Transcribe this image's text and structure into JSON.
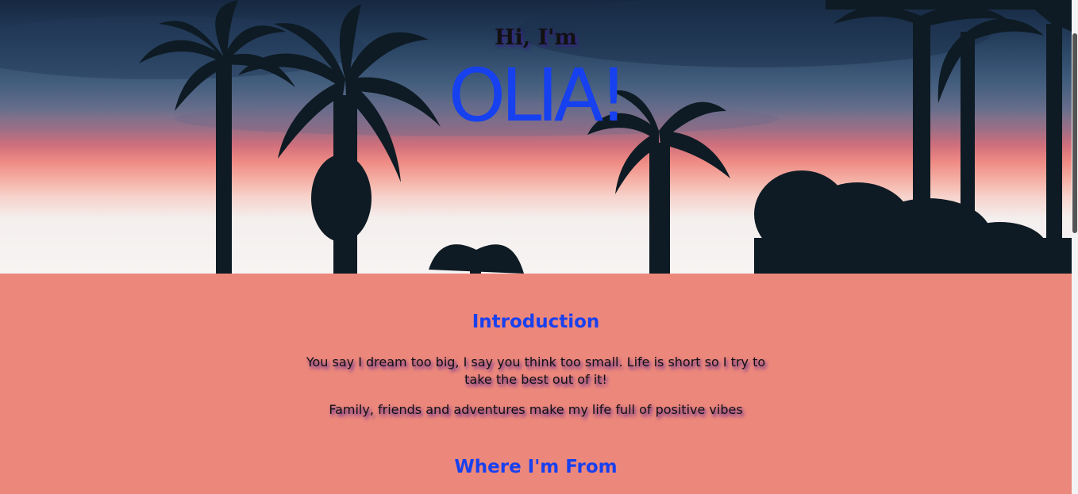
{
  "hero": {
    "greeting": "Hi, I'm",
    "name": "OLIA!"
  },
  "intro": {
    "title": "Introduction",
    "paragraph_1": "You say I dream too big, I say you think too small. Life is short so I try to take the best out of it!",
    "paragraph_2": "Family, friends and adventures make my life full of positive vibes"
  },
  "where_from": {
    "title": "Where I'm From"
  },
  "colors": {
    "accent": "#1840ef",
    "section_background": "#ec877b",
    "text": "#111111",
    "text_shadow": "#4a1f9a"
  }
}
